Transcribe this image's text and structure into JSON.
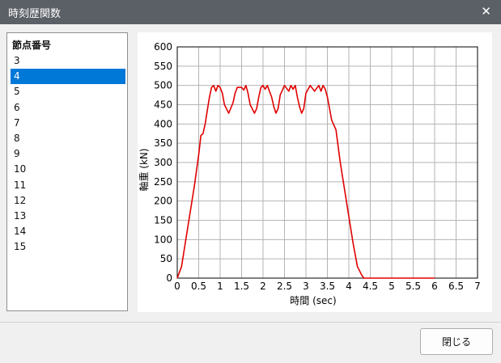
{
  "window": {
    "title": "時刻歴関数",
    "close_symbol": "✕"
  },
  "list": {
    "header": "節点番号",
    "items": [
      "3",
      "4",
      "5",
      "6",
      "7",
      "8",
      "9",
      "10",
      "11",
      "12",
      "13",
      "14",
      "15"
    ],
    "selected": "4"
  },
  "buttons": {
    "close_label": "閉じる"
  },
  "chart_data": {
    "type": "line",
    "xlabel": "時間 (sec)",
    "ylabel": "軸重 (kN)",
    "xlim": [
      0,
      7
    ],
    "ylim": [
      0,
      600
    ],
    "xticks": [
      "0",
      "0.5",
      "1",
      "1.5",
      "2",
      "2.5",
      "3",
      "3.5",
      "4",
      "4.5",
      "5",
      "5.5",
      "6",
      "6.5",
      "7"
    ],
    "yticks": [
      "0",
      "50",
      "100",
      "150",
      "200",
      "250",
      "300",
      "350",
      "400",
      "450",
      "500",
      "550",
      "600"
    ],
    "grid": true,
    "series": [
      {
        "color": "#e00000",
        "x": [
          0,
          0.1,
          0.2,
          0.3,
          0.4,
          0.5,
          0.55,
          0.6,
          0.65,
          0.7,
          0.75,
          0.8,
          0.85,
          0.9,
          0.95,
          1.0,
          1.05,
          1.1,
          1.2,
          1.3,
          1.35,
          1.4,
          1.5,
          1.55,
          1.6,
          1.65,
          1.7,
          1.8,
          1.85,
          1.9,
          1.95,
          2.0,
          2.05,
          2.1,
          2.15,
          2.2,
          2.25,
          2.3,
          2.35,
          2.4,
          2.5,
          2.6,
          2.65,
          2.7,
          2.75,
          2.8,
          2.85,
          2.9,
          2.95,
          3.0,
          3.1,
          3.2,
          3.3,
          3.35,
          3.4,
          3.45,
          3.5,
          3.6,
          3.7,
          3.8,
          3.9,
          4.0,
          4.1,
          4.2,
          4.3,
          4.35,
          4.4,
          5.0,
          5.5,
          6.0
        ],
        "y": [
          0,
          30,
          100,
          170,
          240,
          320,
          370,
          375,
          400,
          435,
          470,
          495,
          500,
          485,
          500,
          495,
          480,
          450,
          428,
          455,
          480,
          495,
          495,
          488,
          500,
          480,
          450,
          428,
          440,
          470,
          495,
          500,
          490,
          500,
          485,
          470,
          445,
          428,
          440,
          475,
          500,
          485,
          500,
          490,
          500,
          470,
          445,
          428,
          440,
          480,
          500,
          485,
          500,
          485,
          500,
          490,
          470,
          410,
          385,
          300,
          230,
          160,
          90,
          30,
          8,
          0,
          0,
          0,
          0,
          0
        ]
      }
    ]
  }
}
